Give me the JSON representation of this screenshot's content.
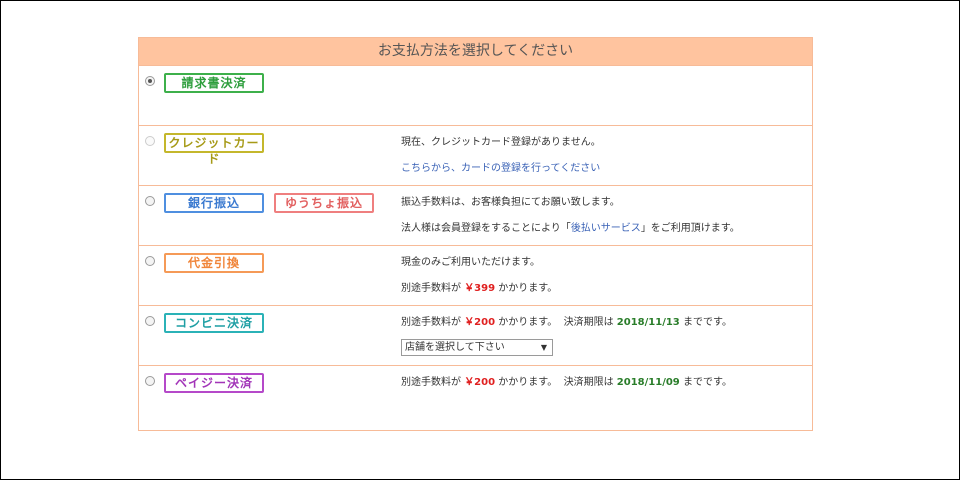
{
  "header": {
    "title": "お支払方法を選択してください"
  },
  "rows": {
    "invoice": {
      "badge": "請求書決済",
      "checked": true
    },
    "credit": {
      "badge": "クレジットカード",
      "line1": "現在、クレジットカード登録がありません。",
      "link": "こちらから、カードの登録を行ってください"
    },
    "bank": {
      "badge": "銀行振込",
      "badge2": "ゆうちょ振込",
      "line1": "振込手数料は、お客様負担にてお願い致します。",
      "line2_pre": "法人様は会員登録をすることにより「",
      "line2_link": "後払いサービス",
      "line2_post": "」をご利用頂けます。"
    },
    "cod": {
      "badge": "代金引換",
      "line1": "現金のみご利用いただけます。",
      "fee_pre": "別途手数料が",
      "fee_price": "￥399",
      "fee_post": "かかります。"
    },
    "conv": {
      "badge": "コンビニ決済",
      "fee_pre": "別途手数料が",
      "fee_price": "￥200",
      "fee_post": "かかります。",
      "deadline_pre": "決済期限は",
      "deadline_date": "2018/11/13",
      "deadline_post": "までです。",
      "store_select": "店舗を選択して下さい"
    },
    "payeasy": {
      "badge": "ペイジー決済",
      "fee_pre": "別途手数料が",
      "fee_price": "￥200",
      "fee_post": "かかります。",
      "deadline_pre": "決済期限は",
      "deadline_date": "2018/11/09",
      "deadline_post": "までです。"
    }
  }
}
